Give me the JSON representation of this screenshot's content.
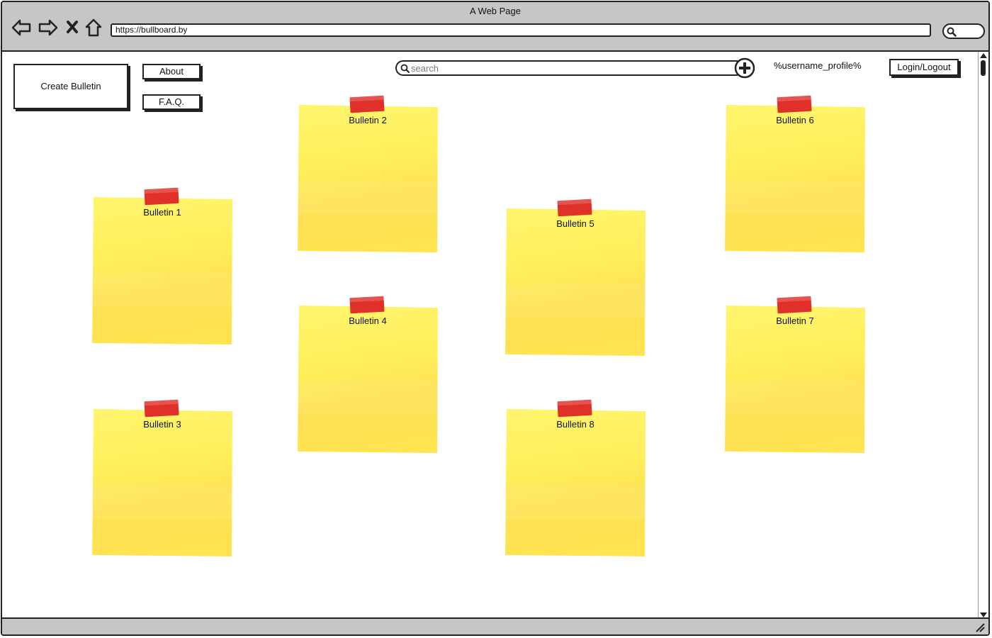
{
  "browser": {
    "window_title": "A Web Page",
    "url": "https://bullboard.by"
  },
  "toolbar": {
    "create_bulletin": "Create Bulletin",
    "about": "About",
    "faq": "F.A.Q.",
    "search_placeholder": "search",
    "username": "%username_profile%",
    "login_logout": "Login/Logout"
  },
  "bulletins": [
    {
      "label": "Bulletin 1"
    },
    {
      "label": "Bulletin 2"
    },
    {
      "label": "Bulletin 3"
    },
    {
      "label": "Bulletin 4"
    },
    {
      "label": "Bulletin 5"
    },
    {
      "label": "Bulletin 6"
    },
    {
      "label": "Bulletin 7"
    },
    {
      "label": "Bulletin 8"
    }
  ],
  "colors": {
    "note": "#ffe85a",
    "tape": "#e0302a",
    "chrome": "#c6c6c6"
  }
}
